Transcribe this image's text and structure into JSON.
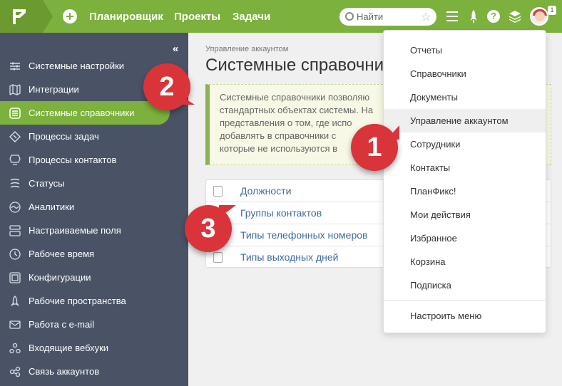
{
  "topbar": {
    "nav": [
      "Планировщик",
      "Проекты",
      "Задачи"
    ],
    "search_placeholder": "Найти",
    "badge": "1",
    "icons": [
      "logo-icon",
      "plus-icon",
      "search-icon",
      "star-icon",
      "menu-icon",
      "rocket-icon",
      "help-icon",
      "layers-icon",
      "avatar"
    ]
  },
  "sidebar": {
    "collapse_label": "«",
    "items": [
      {
        "label": "Системные настройки",
        "icon": "sliders-icon"
      },
      {
        "label": "Интеграции",
        "icon": "map-icon"
      },
      {
        "label": "Системные справочники",
        "icon": "list-icon",
        "active": true
      },
      {
        "label": "Процессы задач",
        "icon": "diamond-icon"
      },
      {
        "label": "Процессы контактов",
        "icon": "contacts-icon"
      },
      {
        "label": "Статусы",
        "icon": "status-icon"
      },
      {
        "label": "Аналитики",
        "icon": "analytics-icon"
      },
      {
        "label": "Настраиваемые поля",
        "icon": "fields-icon"
      },
      {
        "label": "Рабочее время",
        "icon": "clock-icon"
      },
      {
        "label": "Конфигурации",
        "icon": "config-icon"
      },
      {
        "label": "Рабочие пространства",
        "icon": "rocket-icon"
      },
      {
        "label": "Работа с e-mail",
        "icon": "mail-icon"
      },
      {
        "label": "Входящие вебхуки",
        "icon": "webhook-icon"
      },
      {
        "label": "Связь аккаунтов",
        "icon": "link-icon"
      }
    ]
  },
  "main": {
    "breadcrumb": "Управление аккаунтом",
    "title": "Системные справочни",
    "info_lines": [
      "Системные справочники позволяю",
      "стандартных объектах системы. На",
      "представления о том, где испо",
      "добавлять в справочники с",
      "которые не используются в"
    ],
    "directories": [
      "Должности",
      "Группы контактов",
      "Типы телефонных номеров",
      "Типы выходных дней"
    ]
  },
  "dropdown": {
    "items": [
      "Отчеты",
      "Справочники",
      "Документы",
      "Управление аккаунтом",
      "Сотрудники",
      "Контакты",
      "ПланФикс!",
      "Мои действия",
      "Избранное",
      "Корзина",
      "Подписка"
    ],
    "hover_index": 3,
    "footer": "Настроить меню"
  },
  "callouts": [
    "1",
    "2",
    "3"
  ],
  "colors": {
    "accent": "#7db13d",
    "sidebar": "#4a5366",
    "link": "#3d6aa7",
    "callout": "#d9343a"
  }
}
